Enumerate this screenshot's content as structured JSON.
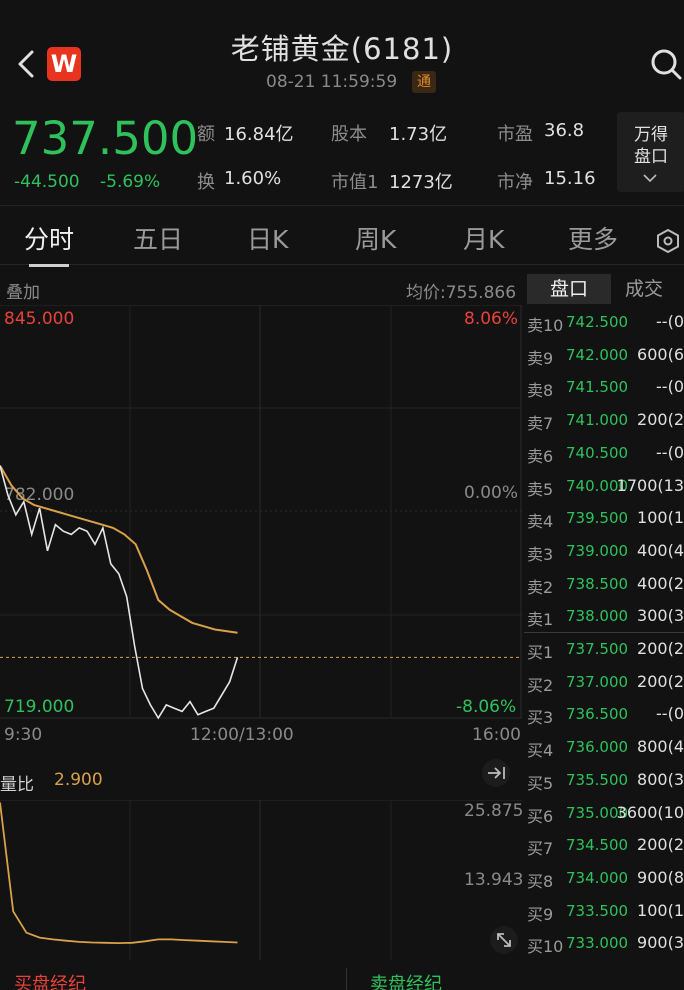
{
  "header": {
    "title": "老铺黄金(6181)",
    "timestamp": "08-21 11:59:59",
    "tong_badge": "通",
    "logo_letter": "W"
  },
  "quote": {
    "price": "737.500",
    "change": "-44.500",
    "change_pct": "-5.69%",
    "stats": [
      {
        "label": "额",
        "value": "16.84亿"
      },
      {
        "label": "股本",
        "value": "1.73亿"
      },
      {
        "label": "市盈",
        "value": "36.8"
      },
      {
        "label": "换",
        "value": "1.60%"
      },
      {
        "label": "市值1",
        "value": "1273亿"
      },
      {
        "label": "市净",
        "value": "15.16"
      }
    ],
    "wd_button": {
      "line1": "万得",
      "line2": "盘口"
    }
  },
  "tabs": [
    "分时",
    "五日",
    "日K",
    "周K",
    "月K",
    "更多"
  ],
  "chart": {
    "overlay_label": "叠加",
    "avg_price_label": "均价:755.866",
    "y_high": "845.000",
    "y_mid": "782.000",
    "y_low": "719.000",
    "pct_high": "8.06%",
    "pct_mid": "0.00%",
    "pct_low": "-8.06%",
    "x_start": "9:30",
    "x_mid": "12:00/13:00",
    "x_end": "16:00",
    "volume_ratio_label": "量比",
    "volume_ratio_value": "2.900",
    "vol_high": "25.875",
    "vol_mid": "13.943",
    "colors": {
      "price_line": "#e6e6e6",
      "avg_line": "#d9a14a",
      "up": "#e8423a",
      "down": "#2fc25c"
    }
  },
  "chart_data": {
    "type": "line",
    "title": "",
    "xlabel": "",
    "ylabel": "",
    "ylim": [
      719.0,
      845.0
    ],
    "x_ticks": [
      "9:30",
      "12:00/13:00",
      "16:00"
    ],
    "series": [
      {
        "values": [
          796,
          787,
          781,
          785,
          775,
          783,
          770,
          778,
          776,
          775,
          777,
          776,
          772,
          777,
          766,
          763,
          756,
          741,
          728,
          723,
          719,
          723,
          722,
          721,
          724,
          720,
          721,
          722,
          726,
          730,
          737.5
        ]
      },
      {
        "values": [
          796,
          790,
          786,
          784,
          783,
          782,
          781,
          780,
          779,
          778,
          777,
          775,
          772,
          764,
          755,
          752,
          750,
          748,
          747,
          746,
          745.5,
          745
        ]
      }
    ],
    "volume_ratio": {
      "ylim": [
        2.0,
        25.875
      ],
      "values": [
        25.8,
        8,
        4.5,
        3.7,
        3.4,
        3.2,
        3.0,
        2.9,
        2.85,
        2.8,
        2.85,
        3.1,
        3.4,
        3.4,
        3.3,
        3.2,
        3.1,
        3.0,
        2.9
      ]
    }
  },
  "orderbook": {
    "tab_active": "盘口",
    "tab_other": "成交",
    "sells": [
      {
        "label": "卖10",
        "price": "742.500",
        "qty": "--(0"
      },
      {
        "label": "卖9",
        "price": "742.000",
        "qty": "600(6"
      },
      {
        "label": "卖8",
        "price": "741.500",
        "qty": "--(0"
      },
      {
        "label": "卖7",
        "price": "741.000",
        "qty": "200(2"
      },
      {
        "label": "卖6",
        "price": "740.500",
        "qty": "--(0"
      },
      {
        "label": "卖5",
        "price": "740.000",
        "qty": "1700(13"
      },
      {
        "label": "卖4",
        "price": "739.500",
        "qty": "100(1"
      },
      {
        "label": "卖3",
        "price": "739.000",
        "qty": "400(4"
      },
      {
        "label": "卖2",
        "price": "738.500",
        "qty": "400(2"
      },
      {
        "label": "卖1",
        "price": "738.000",
        "qty": "300(3"
      }
    ],
    "buys": [
      {
        "label": "买1",
        "price": "737.500",
        "qty": "200(2"
      },
      {
        "label": "买2",
        "price": "737.000",
        "qty": "200(2"
      },
      {
        "label": "买3",
        "price": "736.500",
        "qty": "--(0"
      },
      {
        "label": "买4",
        "price": "736.000",
        "qty": "800(4"
      },
      {
        "label": "买5",
        "price": "735.500",
        "qty": "800(3"
      },
      {
        "label": "买6",
        "price": "735.000",
        "qty": "3600(10"
      },
      {
        "label": "买7",
        "price": "734.500",
        "qty": "200(2"
      },
      {
        "label": "买8",
        "price": "734.000",
        "qty": "900(8"
      },
      {
        "label": "买9",
        "price": "733.500",
        "qty": "100(1"
      },
      {
        "label": "买10",
        "price": "733.000",
        "qty": "900(3"
      }
    ]
  },
  "bottom": {
    "buy_broker": "买盘经纪",
    "sell_broker": "卖盘经纪"
  }
}
